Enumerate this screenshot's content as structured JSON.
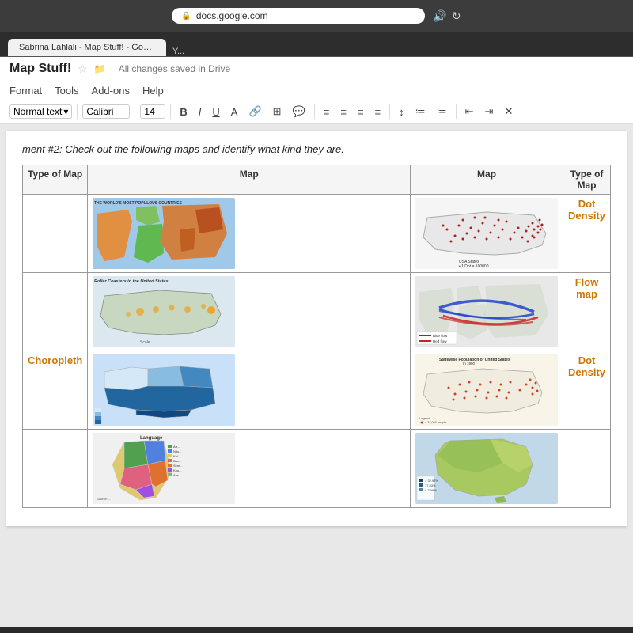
{
  "browser": {
    "address": "docs.google.com",
    "tab_label": "Sabrina Lahlali - Map Stuff! - Google Docs",
    "tab_right": "Y..."
  },
  "document": {
    "title": "Map Stuff!",
    "save_status": "All changes saved in Drive",
    "menu": [
      "Format",
      "Tools",
      "Add-ons",
      "Help"
    ],
    "toolbar": {
      "style": "Normal text",
      "font": "Calibri",
      "size": "14",
      "bold": "B",
      "italic": "I",
      "underline": "U"
    },
    "assignment_text": "ment #2:  Check out the following maps and identify what kind they are.",
    "table": {
      "headers": [
        "Type of Map",
        "Map",
        "Type of Map"
      ],
      "rows": [
        {
          "map_left": "World's Most Populous Countries",
          "type_left": "",
          "map_right": "USA Dot Density",
          "type_right": "Dot Density"
        },
        {
          "map_left": "Roller Coasters in the United States",
          "type_left": "",
          "map_right": "Flow Map USA",
          "type_right": "Flow map"
        },
        {
          "map_left": "USA Choropleth Blue",
          "type_left": "Choropleth",
          "map_right": "Statewise Population USA Dot Density",
          "type_right": "Dot Density"
        },
        {
          "map_left": "Language Map Africa",
          "type_left": "",
          "map_right": "Australia Choropleth",
          "type_right": ""
        }
      ]
    }
  },
  "colors": {
    "accent_orange": "#cc7700",
    "dot_red": "#aa2222",
    "flow_blue": "#2244cc",
    "flow_red": "#cc2222"
  }
}
